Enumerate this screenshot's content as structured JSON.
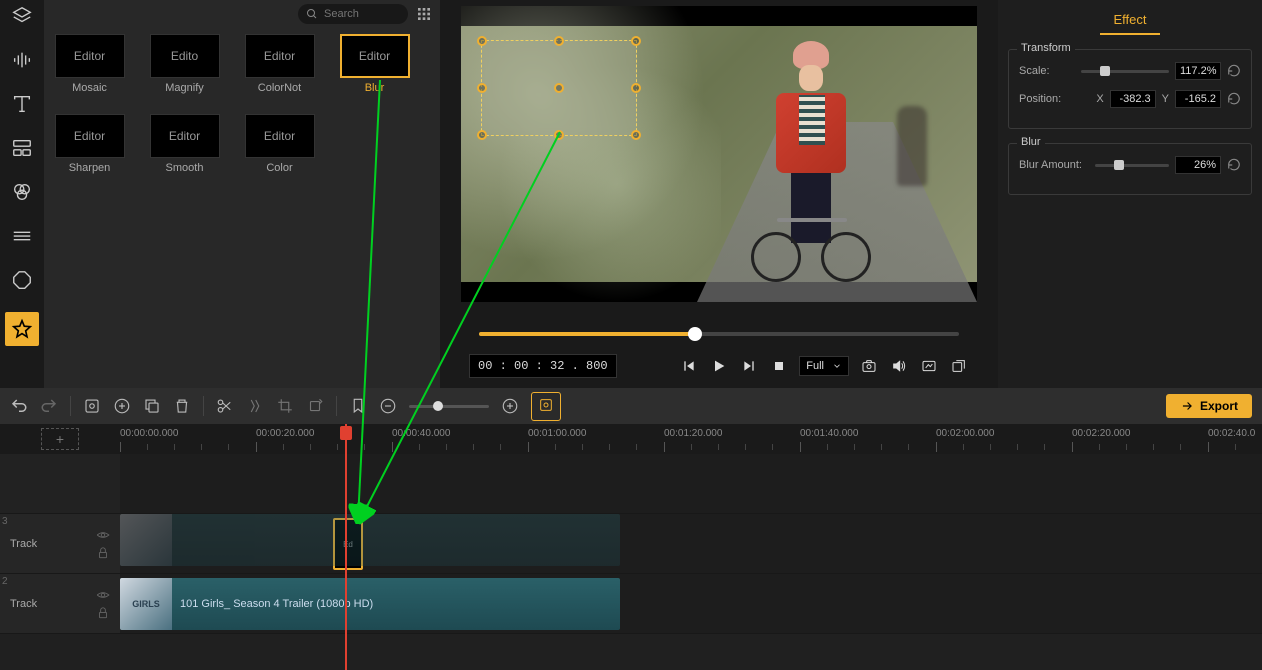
{
  "search": {
    "placeholder": "Search"
  },
  "effects": [
    {
      "thumb": "Editor",
      "label": "Mosaic",
      "selected": false
    },
    {
      "thumb": "Edito",
      "label": "Magnify",
      "selected": false
    },
    {
      "thumb": "Editor",
      "label": "ColorNot",
      "selected": false
    },
    {
      "thumb": "Editor",
      "label": "Blur",
      "selected": true
    },
    {
      "thumb": "Editor",
      "label": "Sharpen",
      "selected": false
    },
    {
      "thumb": "Editor",
      "label": "Smooth",
      "selected": false
    },
    {
      "thumb": "Editor",
      "label": "Color",
      "selected": false
    }
  ],
  "preview": {
    "timecode": "00 : 00 : 32 . 800",
    "quality": "Full"
  },
  "rightPanel": {
    "title": "Effect",
    "transform": {
      "section": "Transform",
      "scaleLabel": "Scale:",
      "scaleValue": "117.2%",
      "positionLabel": "Position:",
      "xLabel": "X",
      "xValue": "-382.3",
      "yLabel": "Y",
      "yValue": "-165.2"
    },
    "blur": {
      "section": "Blur",
      "amountLabel": "Blur Amount:",
      "amountValue": "26%"
    }
  },
  "export": {
    "label": "Export"
  },
  "ruler": {
    "ticks": [
      "00:00:00.000",
      "00:00:20.000",
      "00:00:40.000",
      "00:01:00.000",
      "00:01:20.000",
      "00:01:40.000",
      "00:02:00.000",
      "00:02:20.000",
      "00:02:40.0"
    ]
  },
  "tracks": {
    "t3": {
      "num": "3",
      "label": "Track"
    },
    "t2": {
      "num": "2",
      "label": "Track"
    }
  },
  "clips": {
    "effect": "Ed",
    "videoThumb": "GIRLS",
    "videoLabel": "101 Girls_ Season 4 Trailer (1080p HD)"
  }
}
